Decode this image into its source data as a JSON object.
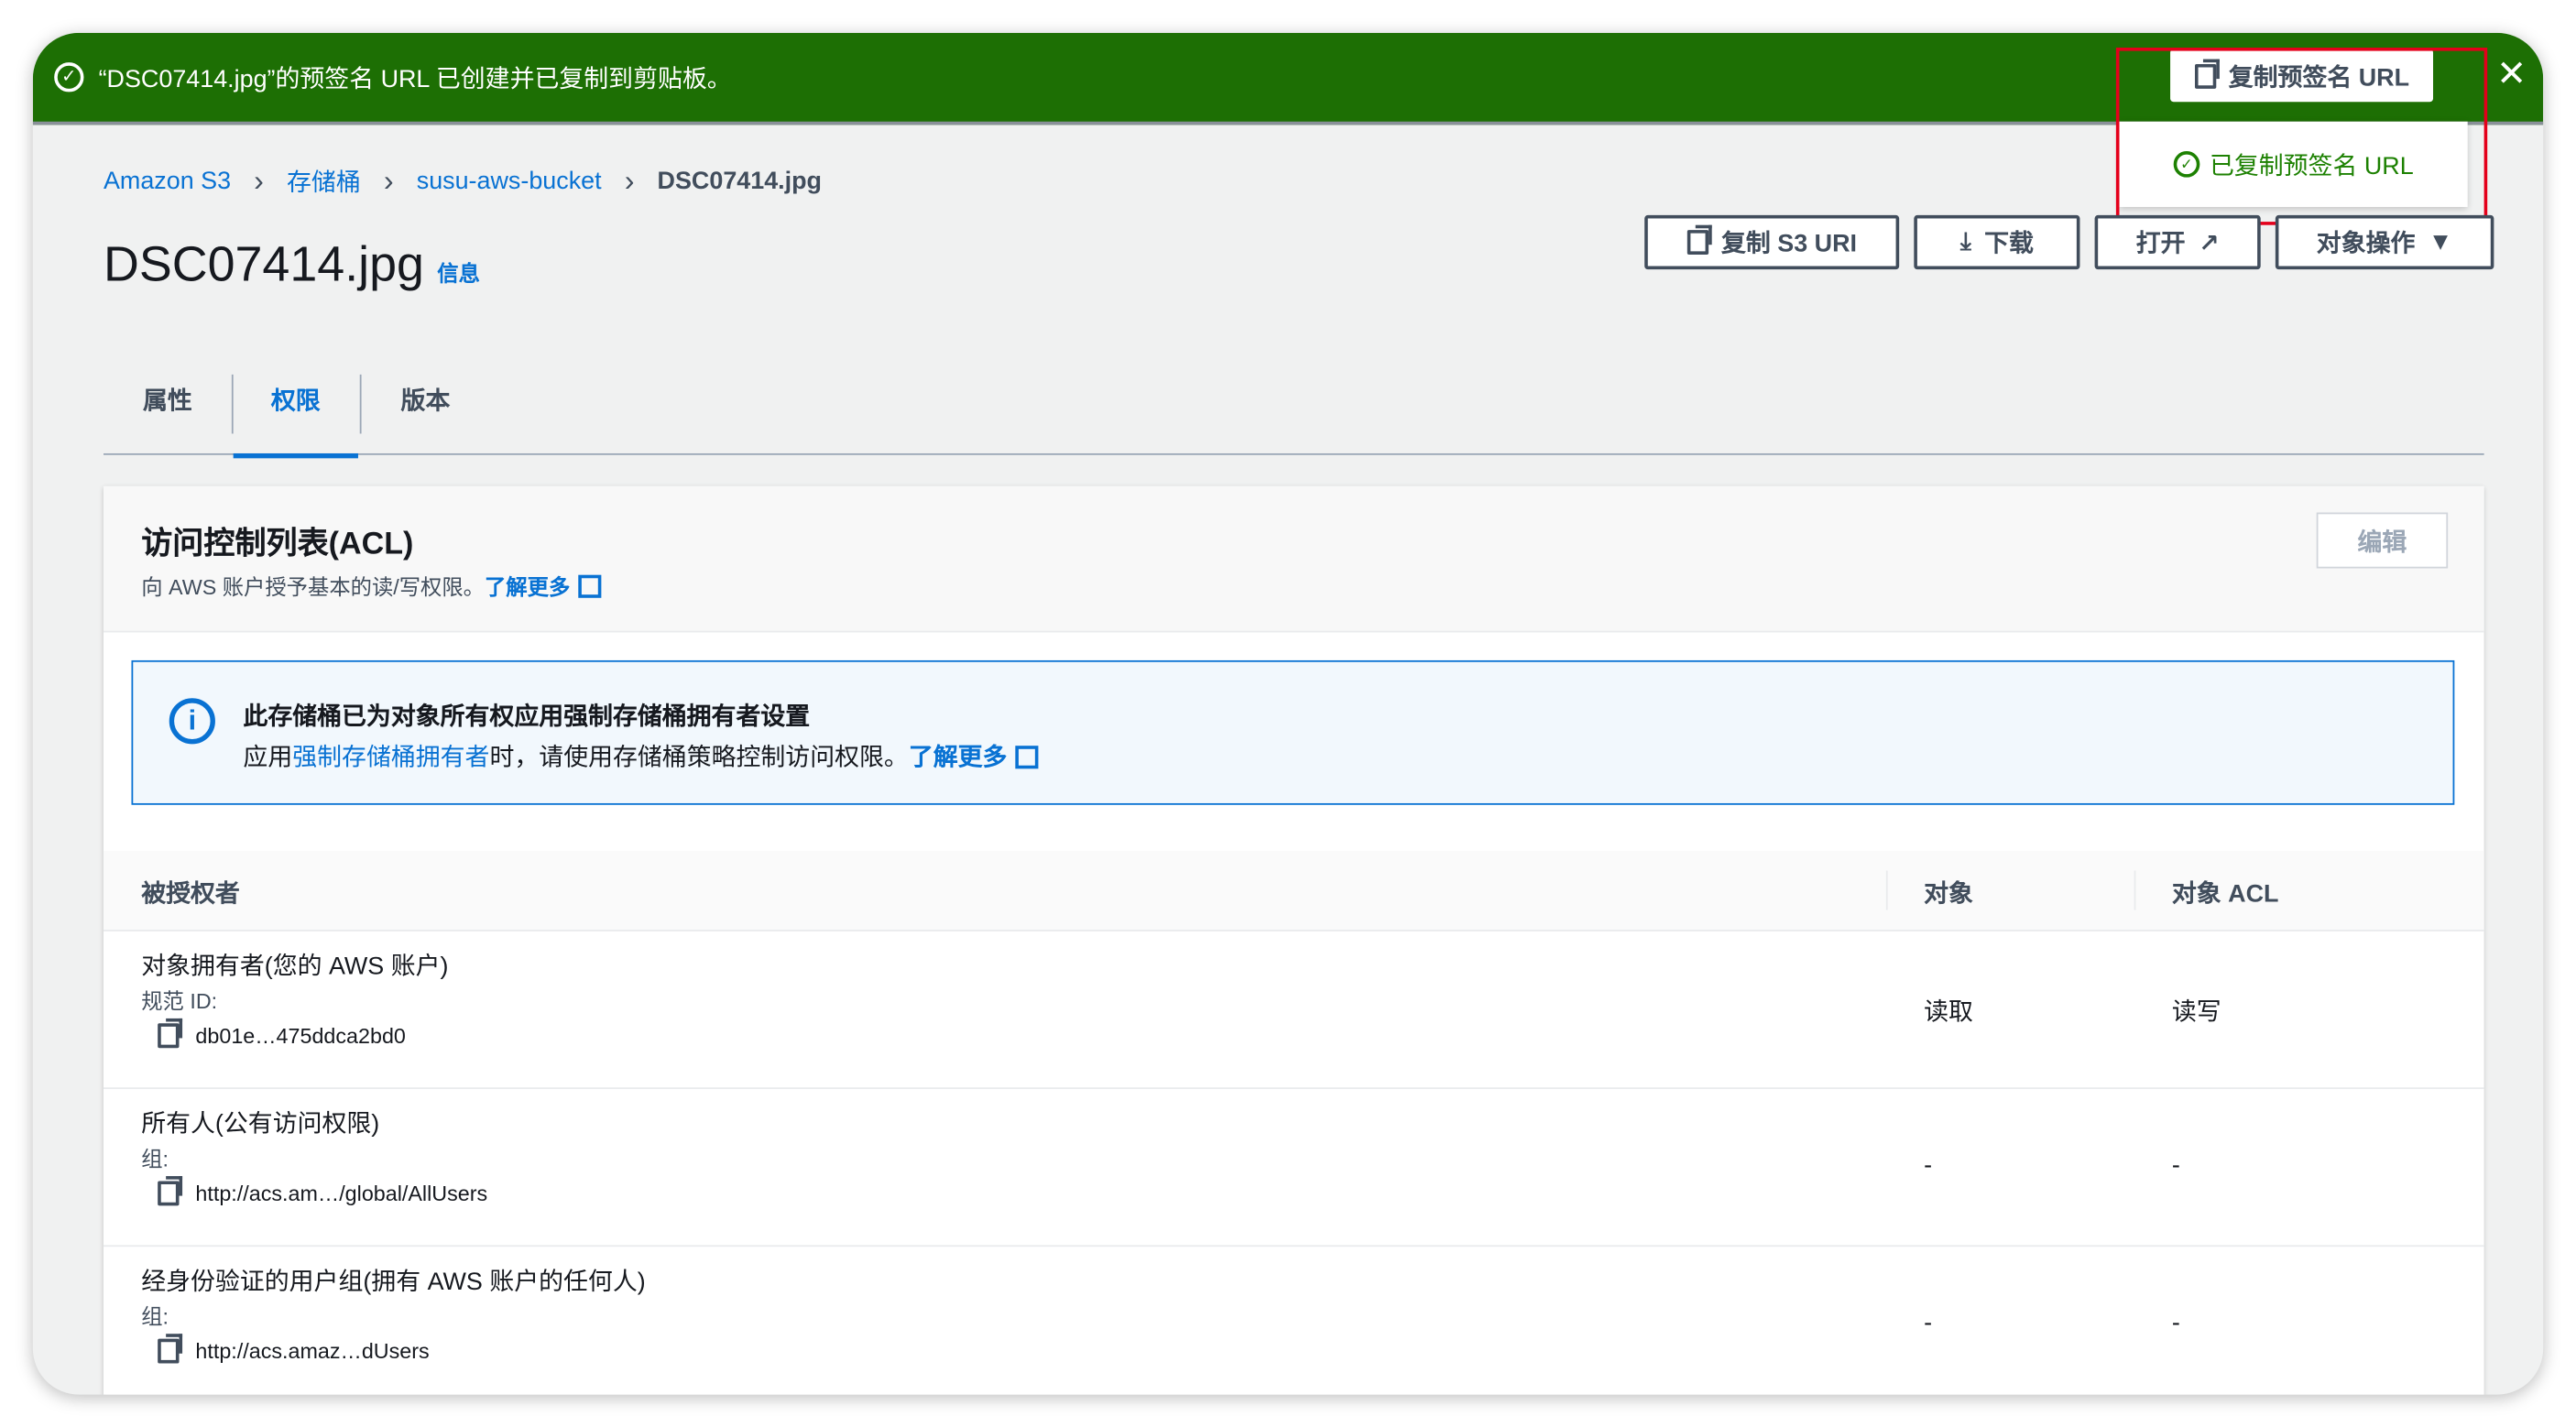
{
  "notification": {
    "message": "“DSC07414.jpg”的预签名 URL 已创建并已复制到剪贴板。",
    "action_label": "复制预签名 URL",
    "popover": "已复制预签名 URL",
    "icon": "check-circle-icon",
    "color": "#1d6f04"
  },
  "breadcrumb": [
    "Amazon S3",
    "存储桶",
    "susu-aws-bucket",
    "DSC07414.jpg"
  ],
  "page": {
    "title": "DSC07414.jpg",
    "info": "信息"
  },
  "actions": {
    "copy_uri": "复制 S3 URI",
    "download": "下载",
    "open": "打开",
    "object_actions": "对象操作"
  },
  "tabs": [
    {
      "label": "属性"
    },
    {
      "label": "权限",
      "active": true
    },
    {
      "label": "版本"
    }
  ],
  "acl": {
    "title": "访问控制列表(ACL)",
    "desc": "向 AWS 账户授予基本的读/写权限。",
    "learn_more": "了解更多",
    "edit": "编辑"
  },
  "alert": {
    "title": "此存储桶已为对象所有权应用强制存储桶拥有者设置",
    "pre": "应用",
    "link": "强制存储桶拥有者",
    "post": "时，请使用存储桶策略控制访问权限。",
    "learn_more": "了解更多"
  },
  "table": {
    "headers": [
      "被授权者",
      "对象",
      "对象 ACL"
    ],
    "rows": [
      {
        "name": "对象拥有者(您的 AWS 账户)",
        "label": "规范 ID:",
        "value": "db01e…475ddca2bd0",
        "object": "读取",
        "acl": "读写"
      },
      {
        "name": "所有人(公有访问权限)",
        "label": "组:",
        "value": "http://acs.am…/global/AllUsers",
        "object": "-",
        "acl": "-"
      },
      {
        "name": "经身份验证的用户组(拥有 AWS 账户的任何人)",
        "label": "组:",
        "value": "http://acs.amaz…dUsers",
        "object": "-",
        "acl": "-"
      }
    ]
  }
}
